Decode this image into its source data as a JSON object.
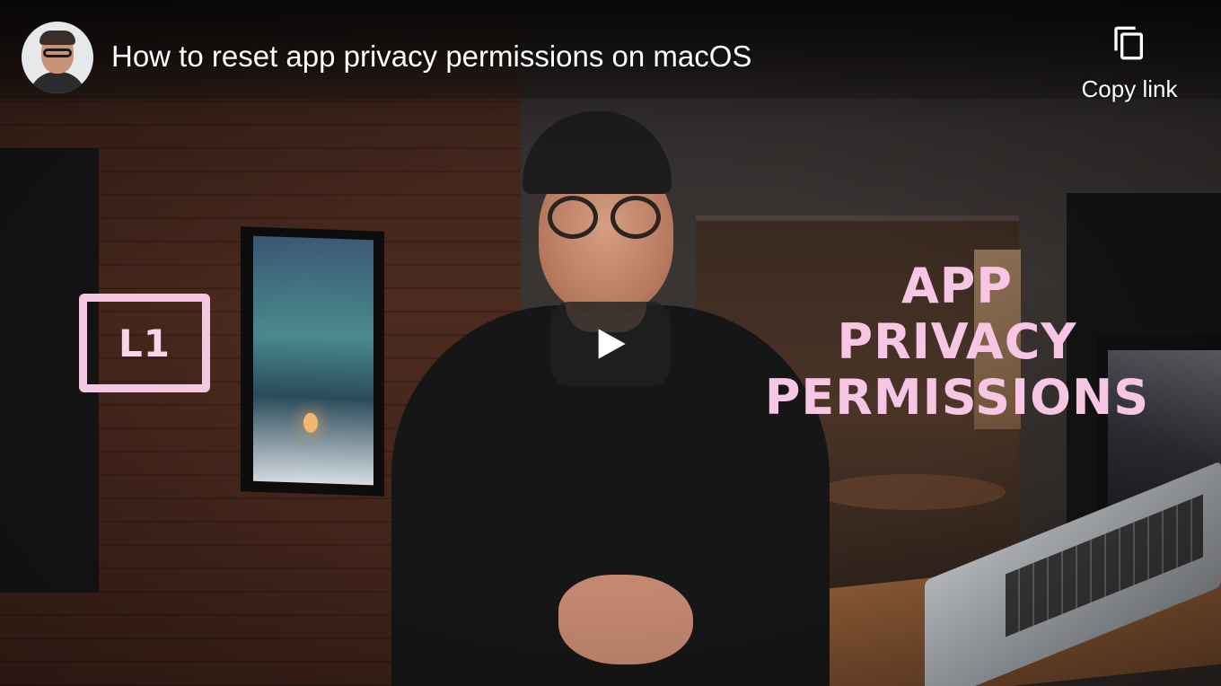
{
  "video": {
    "title": "How to reset app privacy permissions on macOS"
  },
  "channel": {
    "avatar_icon": "channel-avatar"
  },
  "actions": {
    "copy_link_label": "Copy link",
    "copy_link_icon": "copy-icon"
  },
  "player": {
    "play_icon": "play-icon"
  },
  "thumbnail": {
    "logo_text": "L1",
    "overlay_lines": [
      "APP",
      "PRIVACY",
      "PERMISSIONS"
    ],
    "overlay_color": "#f6c6e4"
  },
  "colors": {
    "play_button_bg": "#212121",
    "text": "#ffffff"
  }
}
